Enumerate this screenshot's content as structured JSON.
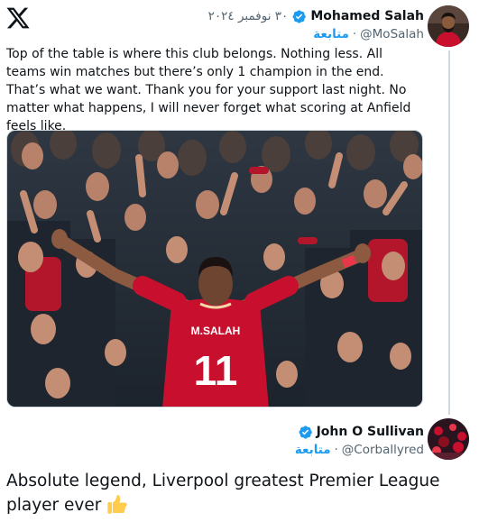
{
  "tweet": {
    "author_name": "Mohamed Salah",
    "date": "٣٠ نوفمبر ٢٠٢٤",
    "handle": "@MoSalah",
    "follow_label": "متابعة",
    "separator": "·",
    "text": "Top of the table is where this club belongs. Nothing less. All teams win matches but there’s only 1 champion in the end. That’s what we want. Thank you for your support last night. No matter what happens, I will never forget what scoring at Anfield feels like.",
    "media": {
      "jersey_name": "M.SALAH",
      "jersey_number": "11"
    }
  },
  "reply": {
    "author_name": "John O Sullivan",
    "handle": "@Corballyred",
    "follow_label": "متابعة",
    "separator": "·",
    "text": "Absolute legend, Liverpool greatest Premier League player ever"
  },
  "icons": {
    "logo": "x-logo-icon",
    "verified": "verified-badge-icon",
    "emoji": "thumbs-up-emoji"
  },
  "colors": {
    "accent": "#1d9bf0",
    "text": "#0f1419",
    "muted": "#536471",
    "jersey": "#c8102e",
    "divider": "#cfd9de"
  }
}
